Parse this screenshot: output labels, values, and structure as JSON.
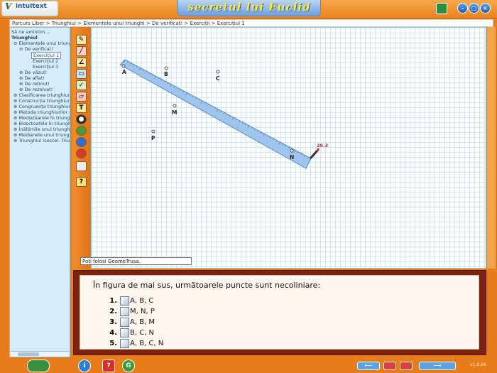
{
  "app": {
    "title": "secretul lui Euclid",
    "logo_initial": "V",
    "logo_text": "intuitext",
    "version": "v1.0.16"
  },
  "breadcrumb": "Parcurs Liber > Triunghiul > Elementele unui triunghi > De verificat! > Exerciții > Exercițiul 1",
  "tree": {
    "items": [
      {
        "label": "Să ne amintim..."
      },
      {
        "label": "Triunghiul"
      },
      {
        "label": "Elementele unui triunghi"
      },
      {
        "label": "De verificat!"
      },
      {
        "label": "Exercițiul 1"
      },
      {
        "label": "Exercițiul 2"
      },
      {
        "label": "Exercițiul 3"
      },
      {
        "label": "De văzut!"
      },
      {
        "label": "De aflat!"
      },
      {
        "label": "De reținut!"
      },
      {
        "label": "De rezolvat!"
      },
      {
        "label": "Clasificarea triunghiurilor"
      },
      {
        "label": "Construcția triunghiurilor"
      },
      {
        "label": "Congruența triunghiurilor"
      },
      {
        "label": "Metoda triunghiurilor congruente"
      },
      {
        "label": "Mediatoarele în triunghi"
      },
      {
        "label": "Bisectoarele în triunghi"
      },
      {
        "label": "Înălțimile unui triunghi"
      },
      {
        "label": "Medianele unui triunghi"
      },
      {
        "label": "Triunghiul isoscel. Triunghiul echilateral"
      }
    ]
  },
  "tools": {
    "text_label": "T",
    "help_label": "?"
  },
  "canvas": {
    "points": [
      {
        "label": "A"
      },
      {
        "label": "B"
      },
      {
        "label": "C"
      },
      {
        "label": "M"
      },
      {
        "label": "P"
      },
      {
        "label": "N"
      }
    ],
    "ruler_reading": "29.3"
  },
  "hint": "Poți folosi GeomeTrusa.",
  "question": {
    "text": "În figura de mai sus, următoarele puncte sunt necoliniare:",
    "options": [
      {
        "num": "1.",
        "label": "A, B, C"
      },
      {
        "num": "2.",
        "label": "M, N, P"
      },
      {
        "num": "3.",
        "label": "A, B, M"
      },
      {
        "num": "4.",
        "label": "B, C, N"
      },
      {
        "num": "5.",
        "label": "A, B, C, N"
      }
    ]
  },
  "bottom": {
    "info_label": "i",
    "help_label": "?",
    "g_label": "G"
  },
  "colors": {
    "frame": "#e77c1a",
    "title_text": "#ffe83a",
    "tree_bg": "#d6ecf8",
    "question_border": "#7b2310",
    "ruler": "#9ec5ee"
  }
}
